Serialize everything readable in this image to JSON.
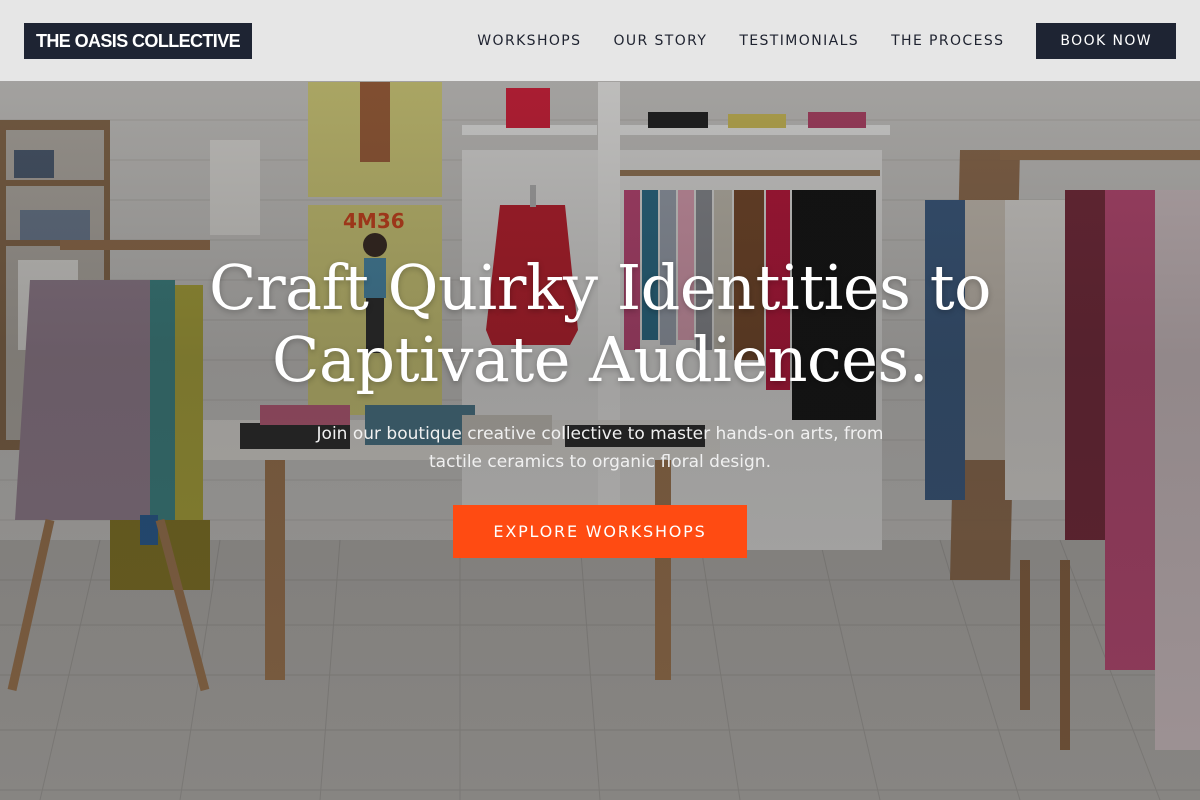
{
  "brand": {
    "logo_text": "THE OASIS COLLECTIVE"
  },
  "nav": {
    "items": [
      {
        "label": "WORKSHOPS"
      },
      {
        "label": "OUR STORY"
      },
      {
        "label": "TESTIMONIALS"
      },
      {
        "label": "THE PROCESS"
      }
    ],
    "cta_label": "BOOK NOW"
  },
  "hero": {
    "title_line1": "Craft Quirky Identities to",
    "title_line2": "Captivate Audiences.",
    "subtitle_line1": "Join our boutique creative collective to master hands-on arts, from",
    "subtitle_line2": "tactile ceramics to organic floral design.",
    "cta_label": "EXPLORE WORKSHOPS",
    "background_description_icon": "boutique-store-photo",
    "poster_text": "4M36"
  },
  "colors": {
    "header_bg": "#ececec",
    "navy": "#1e2433",
    "accent": "#ff4b12",
    "hero_text": "#ffffff"
  }
}
